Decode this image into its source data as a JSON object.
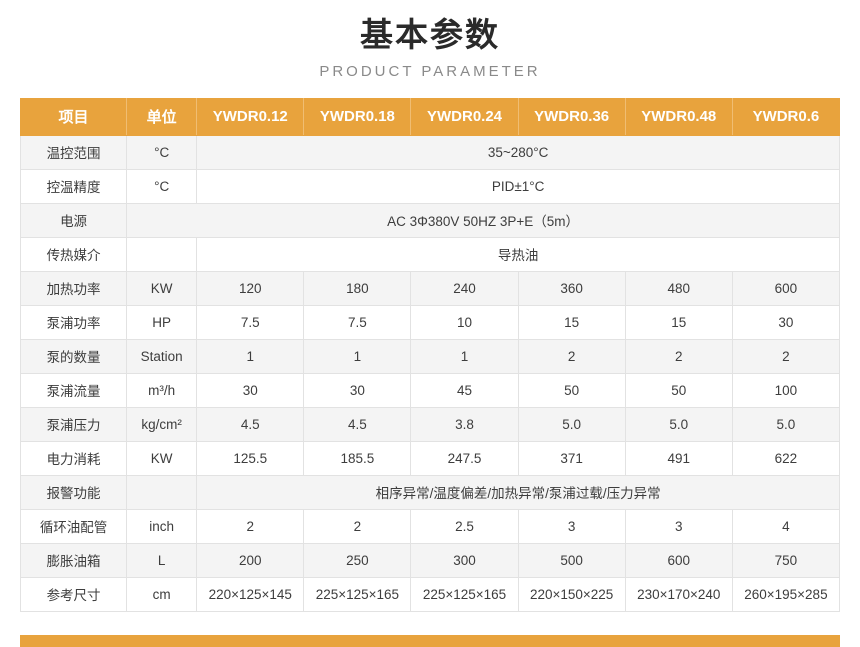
{
  "header": {
    "title": "基本参数",
    "subtitle": "PRODUCT PARAMETER"
  },
  "colors": {
    "accent": "#e8a33d",
    "row_odd": "#f4f4f4",
    "row_even": "#ffffff",
    "border": "#e2e2e2"
  },
  "table": {
    "columns": [
      "项目",
      "单位",
      "YWDR0.12",
      "YWDR0.18",
      "YWDR0.24",
      "YWDR0.36",
      "YWDR0.48",
      "YWDR0.6"
    ],
    "rows": [
      {
        "label": "温控范围",
        "unit": "°C",
        "merged": "35~280°C"
      },
      {
        "label": "控温精度",
        "unit": "°C",
        "merged": "PID±1°C"
      },
      {
        "label": "电源",
        "unit": "",
        "merged_all": "AC 3Φ380V 50HZ  3P+E（5m）"
      },
      {
        "label": "传热媒介",
        "unit": "",
        "merged": "导热油"
      },
      {
        "label": "加热功率",
        "unit": "KW",
        "values": [
          "120",
          "180",
          "240",
          "360",
          "480",
          "600"
        ]
      },
      {
        "label": "泵浦功率",
        "unit": "HP",
        "values": [
          "7.5",
          "7.5",
          "10",
          "15",
          "15",
          "30"
        ]
      },
      {
        "label": "泵的数量",
        "unit": "Station",
        "values": [
          "1",
          "1",
          "1",
          "2",
          "2",
          "2"
        ]
      },
      {
        "label": "泵浦流量",
        "unit": "m³/h",
        "values": [
          "30",
          "30",
          "45",
          "50",
          "50",
          "100"
        ]
      },
      {
        "label": "泵浦压力",
        "unit": "kg/cm²",
        "values": [
          "4.5",
          "4.5",
          "3.8",
          "5.0",
          "5.0",
          "5.0"
        ]
      },
      {
        "label": "电力消耗",
        "unit": "KW",
        "values": [
          "125.5",
          "185.5",
          "247.5",
          "371",
          "491",
          "622"
        ]
      },
      {
        "label": "报警功能",
        "unit": "",
        "merged": "相序异常/温度偏差/加热异常/泵浦过载/压力异常"
      },
      {
        "label": "循环油配管",
        "unit": "inch",
        "values": [
          "2",
          "2",
          "2.5",
          "3",
          "3",
          "4"
        ]
      },
      {
        "label": "膨胀油箱",
        "unit": "L",
        "values": [
          "200",
          "250",
          "300",
          "500",
          "600",
          "750"
        ]
      },
      {
        "label": "参考尺寸",
        "unit": "cm",
        "values": [
          "220×125×145",
          "225×125×165",
          "225×125×165",
          "220×150×225",
          "230×170×240",
          "260×195×285"
        ]
      }
    ]
  }
}
